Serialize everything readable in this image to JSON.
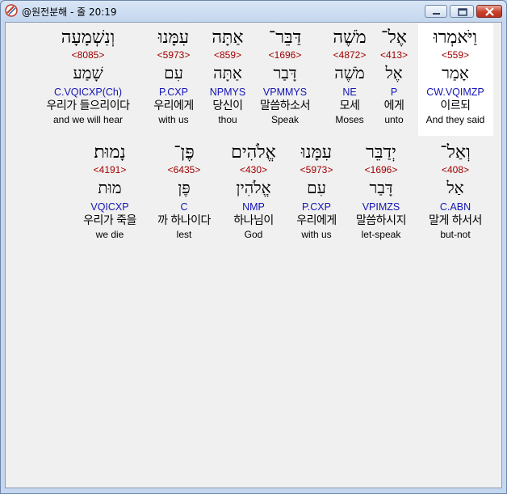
{
  "window": {
    "title": "@원전분해 - 줄 20:19"
  },
  "rows": [
    {
      "words": [
        {
          "hebrew": "וַיֹּאמְרוּ",
          "strong": "<559>",
          "lemma": "אָמַר",
          "parse": "CW.VQIMZP",
          "korean": "이르되",
          "english": "And they said"
        },
        {
          "hebrew": "אֶל־",
          "strong": "<413>",
          "lemma": "אֶל",
          "parse": "P",
          "korean": "에게",
          "english": "unto"
        },
        {
          "hebrew": "מֹשֶׁה",
          "strong": "<4872>",
          "lemma": "מֹשֶׁה",
          "parse": "NE",
          "korean": "모세",
          "english": "Moses"
        },
        {
          "hebrew": "דַּבֵּר־",
          "strong": "<1696>",
          "lemma": "דָּבַר",
          "parse": "VPMMYS",
          "korean": "말씀하소서",
          "english": "Speak"
        },
        {
          "hebrew": "אַתָּה",
          "strong": "<859>",
          "lemma": "אַתָּה",
          "parse": "NPMYS",
          "korean": "당신이",
          "english": "thou"
        },
        {
          "hebrew": "עִמָּנוּ",
          "strong": "<5973>",
          "lemma": "עִם",
          "parse": "P.CXP",
          "korean": "우리에게",
          "english": "with us"
        },
        {
          "hebrew": "וְנִשְׁמָעָה",
          "strong": "<8085>",
          "lemma": "שָׁמַע",
          "parse": "C.VQICXP(Ch)",
          "korean": "우리가 들으리이다",
          "english": "and we will hear"
        }
      ]
    },
    {
      "words": [
        {
          "hebrew": "וְאַל־",
          "strong": "<408>",
          "lemma": "אַל",
          "parse": "C.ABN",
          "korean": "말게 하서서",
          "english": "but-not"
        },
        {
          "hebrew": "יְדַבֵּר",
          "strong": "<1696>",
          "lemma": "דָּבַר",
          "parse": "VPIMZS",
          "korean": "말씀하시지",
          "english": "let-speak"
        },
        {
          "hebrew": "עִמָּנוּ",
          "strong": "<5973>",
          "lemma": "עִם",
          "parse": "P.CXP",
          "korean": "우리에게",
          "english": "with us"
        },
        {
          "hebrew": "אֱלֹהִים",
          "strong": "<430>",
          "lemma": "אֱלֹהִין",
          "parse": "NMP",
          "korean": "하나님이",
          "english": "God"
        },
        {
          "hebrew": "פֶּן־",
          "strong": "<6435>",
          "lemma": "פֶּן",
          "parse": "C",
          "korean": "까 하나이다",
          "english": "lest"
        },
        {
          "hebrew": "נָמוּת׃",
          "strong": "<4191>",
          "lemma": "מוּת",
          "parse": "VQICXP",
          "korean": "우리가 죽을",
          "english": "we die"
        }
      ]
    }
  ],
  "colors": {
    "strong": "#a00000",
    "parse": "#1414b4",
    "highlight": "#ffffff",
    "client_bg": "#f0f0f0"
  }
}
